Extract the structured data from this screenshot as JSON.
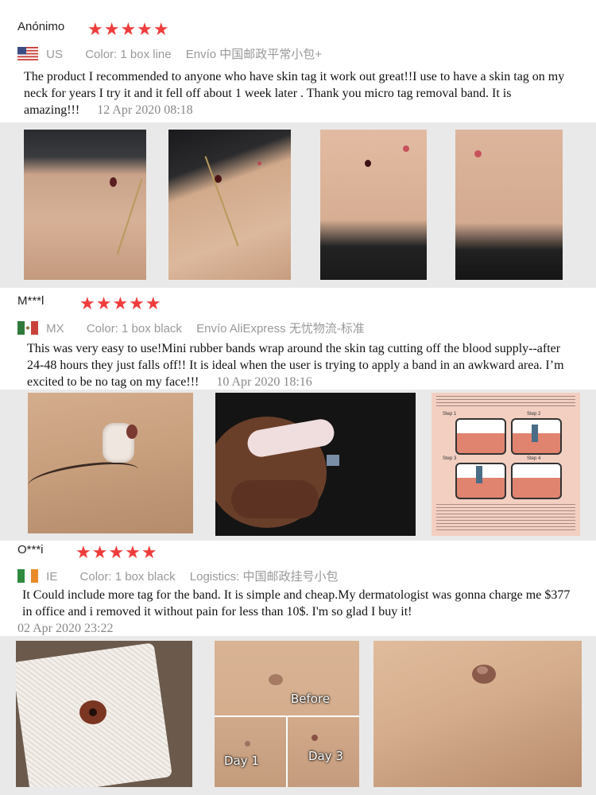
{
  "reviews": [
    {
      "user": "Anónimo",
      "stars": "★★★★★",
      "country_code": "US",
      "color_label": "Color:",
      "color_value": "1 box line",
      "shipping": "Envío 中国邮政平常小包+",
      "text": "The product I recommended to anyone who have skin tag it work out great!!I use to have a skin tag on my neck for years I try it and it fell off about 1 week later . Thank you micro tag removal band. It is amazing!!!",
      "date": "12 Apr 2020 08:18"
    },
    {
      "user": "M***l",
      "stars": "★★★★★",
      "country_code": "MX",
      "color_label": "Color:",
      "color_value": "1 box black",
      "shipping": "Envío AliExpress 无忧物流-标准",
      "text": "This was very easy to use!Mini rubber bands wrap around the skin tag cutting off the blood supply--after 24-48 hours they just falls off!! It is ideal when the user is trying to apply a band in an awkward area. I’m excited to be no tag on my face!!!",
      "date": "10 Apr 2020 18:16",
      "instruction_steps": [
        "Step 1",
        "Step 2",
        "Step 3",
        "Step 4"
      ]
    },
    {
      "user": "O***i",
      "stars": "★★★★★",
      "country_code": "IE",
      "color_label": "Color:",
      "color_value": "1 box black",
      "shipping": "Logistics: 中国邮政挂号小包",
      "text": "It Could include more tag for the band. It is simple and cheap.My dermatologist was gonna charge me $377 in office and i removed it without pain for less than 10$. I'm so glad I buy it!",
      "date": "02 Apr 2020 23:22",
      "photo_captions": [
        "Before",
        "Day 1",
        "Day 3"
      ]
    }
  ]
}
